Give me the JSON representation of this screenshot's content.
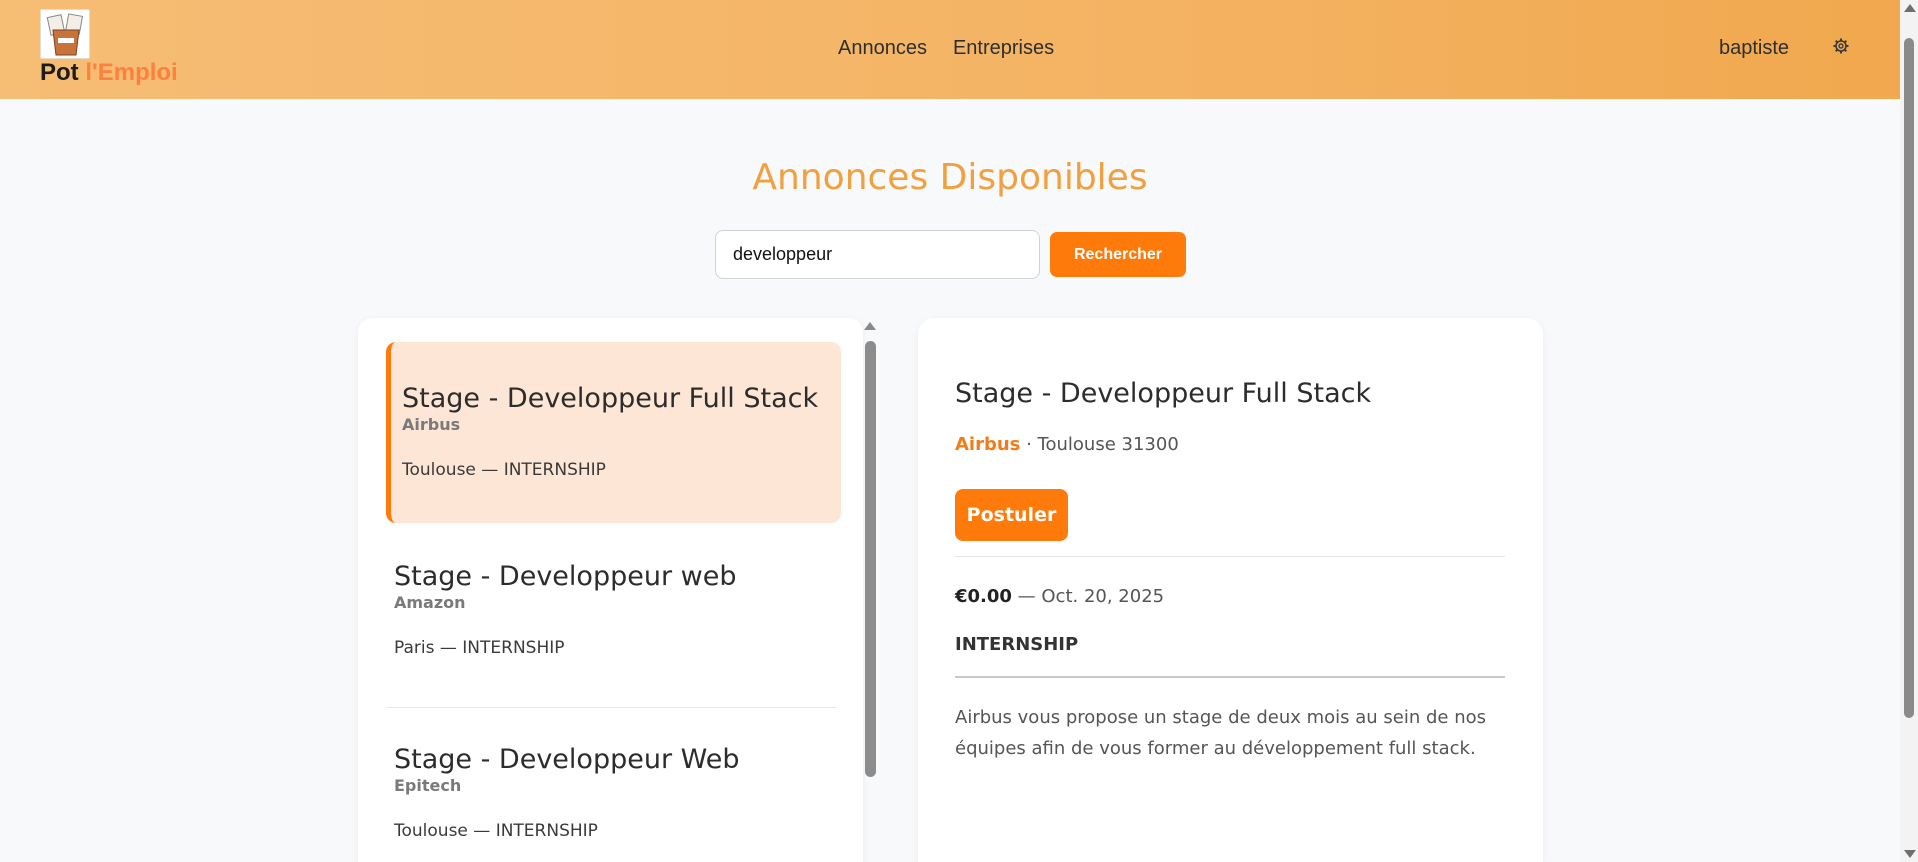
{
  "header": {
    "brand_part1": "Pot",
    "brand_part2": "l'Emploi",
    "nav": [
      "Annonces",
      "Entreprises"
    ],
    "user": "baptiste",
    "settings_icon": "gear-icon"
  },
  "page": {
    "title": "Annonces Disponibles"
  },
  "search": {
    "value": "developpeur",
    "button_label": "Rechercher"
  },
  "jobs": [
    {
      "title": "Stage - Developpeur Full Stack",
      "company": "Airbus",
      "location_type": "Toulouse — INTERNSHIP",
      "active": true
    },
    {
      "title": "Stage - Developpeur web",
      "company": "Amazon",
      "location_type": "Paris — INTERNSHIP",
      "active": false
    },
    {
      "title": "Stage - Developpeur Web",
      "company": "Epitech",
      "location_type": "Toulouse — INTERNSHIP",
      "active": false
    }
  ],
  "detail": {
    "title": "Stage - Developpeur Full Stack",
    "company": "Airbus",
    "location": " · Toulouse 31300",
    "apply_label": "Postuler",
    "salary": "€0.00",
    "date": " — Oct. 20, 2025",
    "type": "INTERNSHIP",
    "description": "Airbus vous propose un stage de deux mois au sein de nos équipes afin de vous former au développement full stack."
  },
  "colors": {
    "accent": "#fd7a0b",
    "title": "#f0a03e",
    "header_start": "#f6bd75",
    "header_end": "#f1a84e",
    "active_card_bg": "#fde6d5"
  }
}
